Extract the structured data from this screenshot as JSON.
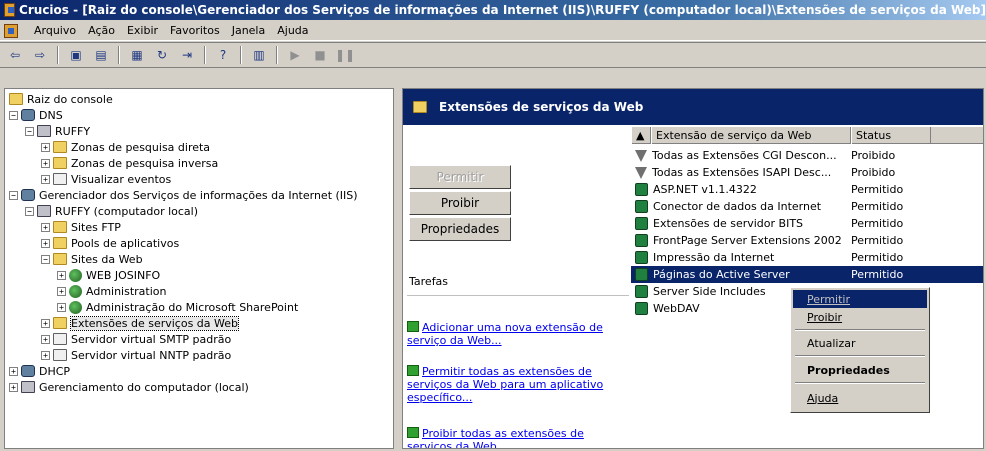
{
  "window": {
    "title": "Crucios - [Raiz do console\\Gerenciador dos Serviços de informações da Internet (IIS)\\RUFFY (computador local)\\Extensões de serviços da Web]"
  },
  "menu": [
    "Arquivo",
    "Ação",
    "Exibir",
    "Favoritos",
    "Janela",
    "Ajuda"
  ],
  "toolbar": {
    "icons": [
      "back-icon",
      "forward-icon",
      "up-folder-icon",
      "show-tree-icon",
      "properties-icon",
      "refresh-icon",
      "export-icon",
      "help-icon",
      "console-icon",
      "play-icon",
      "stop-icon",
      "pause-icon"
    ]
  },
  "tree": {
    "root": "Raiz do console",
    "dns": "DNS",
    "ruffy": "RUFFY",
    "zona_direta": "Zonas de pesquisa direta",
    "zona_inversa": "Zonas de pesquisa inversa",
    "eventos": "Visualizar eventos",
    "iis": "Gerenciador dos Serviços de informações da Internet (IIS)",
    "ruffy_local": "RUFFY (computador local)",
    "ftp": "Sites FTP",
    "pools": "Pools de aplicativos",
    "sites_web": "Sites da Web",
    "web_josinfo": "WEB JOSINFO",
    "administration": "Administration",
    "admin_sharepoint": "Administração do Microsoft SharePoint",
    "extensoes": "Extensões de serviços da Web",
    "smtp": "Servidor virtual SMTP padrão",
    "nntp": "Servidor virtual NNTP padrão",
    "dhcp": "DHCP",
    "gerenciamento": "Gerenciamento do computador (local)"
  },
  "panel": {
    "title": "Extensões de serviços da Web",
    "buttons": {
      "permitir": "Permitir",
      "proibir": "Proibir",
      "propriedades": "Propriedades"
    },
    "tarefas": "Tarefas",
    "tasks": [
      "Adicionar uma nova extensão de serviço da Web...",
      "Permitir todas as extensões de serviços da Web para um aplicativo específico...",
      "Proibir todas as extensões de serviços da Web"
    ]
  },
  "list": {
    "columns": [
      "Extensão de serviço da Web",
      "Status"
    ],
    "rows": [
      {
        "name": "Todas as Extensões CGI Descon...",
        "status": "Proibido"
      },
      {
        "name": "Todas as Extensões ISAPI Desc...",
        "status": "Proibido"
      },
      {
        "name": "ASP.NET v1.1.4322",
        "status": "Permitido"
      },
      {
        "name": "Conector de dados da Internet",
        "status": "Permitido"
      },
      {
        "name": "Extensões de servidor BITS",
        "status": "Permitido"
      },
      {
        "name": "FrontPage Server Extensions 2002",
        "status": "Permitido"
      },
      {
        "name": "Impressão da Internet",
        "status": "Permitido"
      },
      {
        "name": "Páginas do Active Server",
        "status": "Permitido"
      },
      {
        "name": "Server Side Includes",
        "status": ""
      },
      {
        "name": "WebDAV",
        "status": ""
      }
    ]
  },
  "context_menu": {
    "permitir": "Permitir",
    "proibir": "Proibir",
    "atualizar": "Atualizar",
    "propriedades": "Propriedades",
    "ajuda": "Ajuda"
  },
  "colors": {
    "title_blue": "#0a246a",
    "face": "#d4d0c8",
    "link": "#0000ee"
  }
}
